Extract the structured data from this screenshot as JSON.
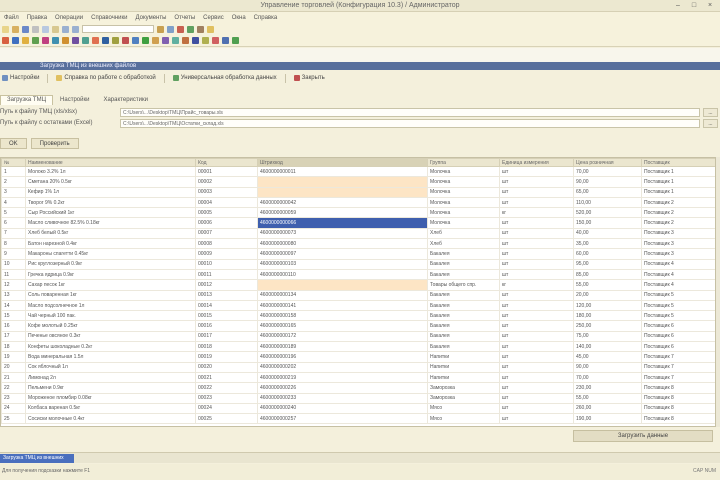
{
  "window": {
    "title": "Управление торговлей (Конфигурация 10.3) / Администратор",
    "controls": [
      "–",
      "□",
      "×"
    ]
  },
  "menu": [
    "Файл",
    "Правка",
    "Операции",
    "Справочники",
    "Документы",
    "Отчеты",
    "Сервис",
    "Окна",
    "Справка"
  ],
  "colors": {
    "title_bar": "#ece8d0",
    "form_header": "#586f9c",
    "selection": "#3f5fae",
    "highlight_row": "#fde5c5",
    "active_task": "#4a6fbe"
  },
  "toolbar_icons": [
    "new-icon",
    "open-icon",
    "save-icon",
    "cut-icon",
    "copy-icon",
    "paste-icon",
    "undo-icon",
    "redo-icon",
    "find-icon",
    "calc-icon",
    "calendar-icon",
    "refresh-icon",
    "settings-icon",
    "help-icon"
  ],
  "form": {
    "header": "Загрузка ТМЦ из внешних файлов",
    "commands": [
      "Настройки",
      "Справка по работе с обработкой",
      "Универсальная обработка данных",
      "Закрыть"
    ],
    "tabs": [
      "Загрузка ТМЦ",
      "Настройки",
      "Характеристики"
    ],
    "params": [
      {
        "label": "Путь к файлу ТМЦ (xls/xlsx)",
        "value": "C:\\Users\\...\\Desktop\\ТМЦ\\Прайс_товары.xls"
      },
      {
        "label": "Путь к файлу с остатками (Excel)",
        "value": "C:\\Users\\...\\Desktop\\ТМЦ\\Остатки_склад.xls"
      }
    ],
    "path_button": "...",
    "actions": [
      "OK",
      "Проверить"
    ],
    "bottom_button": "Загрузить данные"
  },
  "table": {
    "columns": [
      "№",
      "Наименование",
      "Код",
      "Штрихкод",
      "Группа",
      "Единица измерения",
      "Цена розничная",
      "Поставщик"
    ],
    "rows": [
      [
        "1",
        "Молоко 3.2% 1л",
        "00001",
        "4600000000011",
        "Молочка",
        "шт",
        "70,00",
        "Поставщик 1"
      ],
      [
        "2",
        "Сметана 20% 0.5кг",
        "00002",
        "",
        "Молочка",
        "шт",
        "90,00",
        "Поставщик 1"
      ],
      [
        "3",
        "Кефир 1% 1л",
        "00003",
        "",
        "Молочка",
        "шт",
        "65,00",
        "Поставщик 1"
      ],
      [
        "4",
        "Творог 9% 0.2кг",
        "00004",
        "4600000000042",
        "Молочка",
        "шт",
        "110,00",
        "Поставщик 2"
      ],
      [
        "5",
        "Сыр Российский 1кг",
        "00005",
        "4600000000059",
        "Молочка",
        "кг",
        "520,00",
        "Поставщик 2"
      ],
      [
        "6",
        "Масло сливочное 82.5% 0.18кг",
        "00006",
        "4600000000066",
        "Молочка",
        "шт",
        "150,00",
        "Поставщик 2"
      ],
      [
        "7",
        "Хлеб белый 0.5кг",
        "00007",
        "4600000000073",
        "Хлеб",
        "шт",
        "40,00",
        "Поставщик 3"
      ],
      [
        "8",
        "Батон нарезной 0.4кг",
        "00008",
        "4600000000080",
        "Хлеб",
        "шт",
        "35,00",
        "Поставщик 3"
      ],
      [
        "9",
        "Макароны спагетти 0.45кг",
        "00009",
        "4600000000097",
        "Бакалея",
        "шт",
        "60,00",
        "Поставщик 3"
      ],
      [
        "10",
        "Рис круглозерный 0.9кг",
        "00010",
        "4600000000103",
        "Бакалея",
        "шт",
        "95,00",
        "Поставщик 4"
      ],
      [
        "11",
        "Гречка ядрица 0.9кг",
        "00011",
        "4600000000110",
        "Бакалея",
        "шт",
        "85,00",
        "Поставщик 4"
      ],
      [
        "12",
        "Сахар песок 1кг",
        "00012",
        "",
        "Товары общего спр.",
        "кг",
        "55,00",
        "Поставщик 4"
      ],
      [
        "13",
        "Соль поваренная 1кг",
        "00013",
        "4600000000134",
        "Бакалея",
        "шт",
        "20,00",
        "Поставщик 5"
      ],
      [
        "14",
        "Масло подсолнечное 1л",
        "00014",
        "4600000000141",
        "Бакалея",
        "шт",
        "120,00",
        "Поставщик 5"
      ],
      [
        "15",
        "Чай черный 100 пак.",
        "00015",
        "4600000000158",
        "Бакалея",
        "шт",
        "180,00",
        "Поставщик 5"
      ],
      [
        "16",
        "Кофе молотый 0.25кг",
        "00016",
        "4600000000165",
        "Бакалея",
        "шт",
        "250,00",
        "Поставщик 6"
      ],
      [
        "17",
        "Печенье овсяное 0.3кг",
        "00017",
        "4600000000172",
        "Бакалея",
        "шт",
        "75,00",
        "Поставщик 6"
      ],
      [
        "18",
        "Конфеты шоколадные 0.2кг",
        "00018",
        "4600000000189",
        "Бакалея",
        "шт",
        "140,00",
        "Поставщик 6"
      ],
      [
        "19",
        "Вода минеральная 1.5л",
        "00019",
        "4600000000196",
        "Напитки",
        "шт",
        "45,00",
        "Поставщик 7"
      ],
      [
        "20",
        "Сок яблочный 1л",
        "00020",
        "4600000000202",
        "Напитки",
        "шт",
        "90,00",
        "Поставщик 7"
      ],
      [
        "21",
        "Лимонад 2л",
        "00021",
        "4600000000219",
        "Напитки",
        "шт",
        "70,00",
        "Поставщик 7"
      ],
      [
        "22",
        "Пельмени 0.9кг",
        "00022",
        "4600000000226",
        "Заморозка",
        "шт",
        "230,00",
        "Поставщик 8"
      ],
      [
        "23",
        "Мороженое пломбир 0.08кг",
        "00023",
        "4600000000233",
        "Заморозка",
        "шт",
        "55,00",
        "Поставщик 8"
      ],
      [
        "24",
        "Колбаса вареная 0.5кг",
        "00024",
        "4600000000240",
        "Мясо",
        "шт",
        "260,00",
        "Поставщик 8"
      ],
      [
        "25",
        "Сосиски молочные 0.4кг",
        "00025",
        "4600000000257",
        "Мясо",
        "шт",
        "190,00",
        "Поставщик 8"
      ]
    ]
  },
  "taskbar": {
    "active": "Загрузка ТМЦ из внешних"
  },
  "status": {
    "text": "Для получения подсказки нажмите F1",
    "right": "CAP NUM"
  }
}
